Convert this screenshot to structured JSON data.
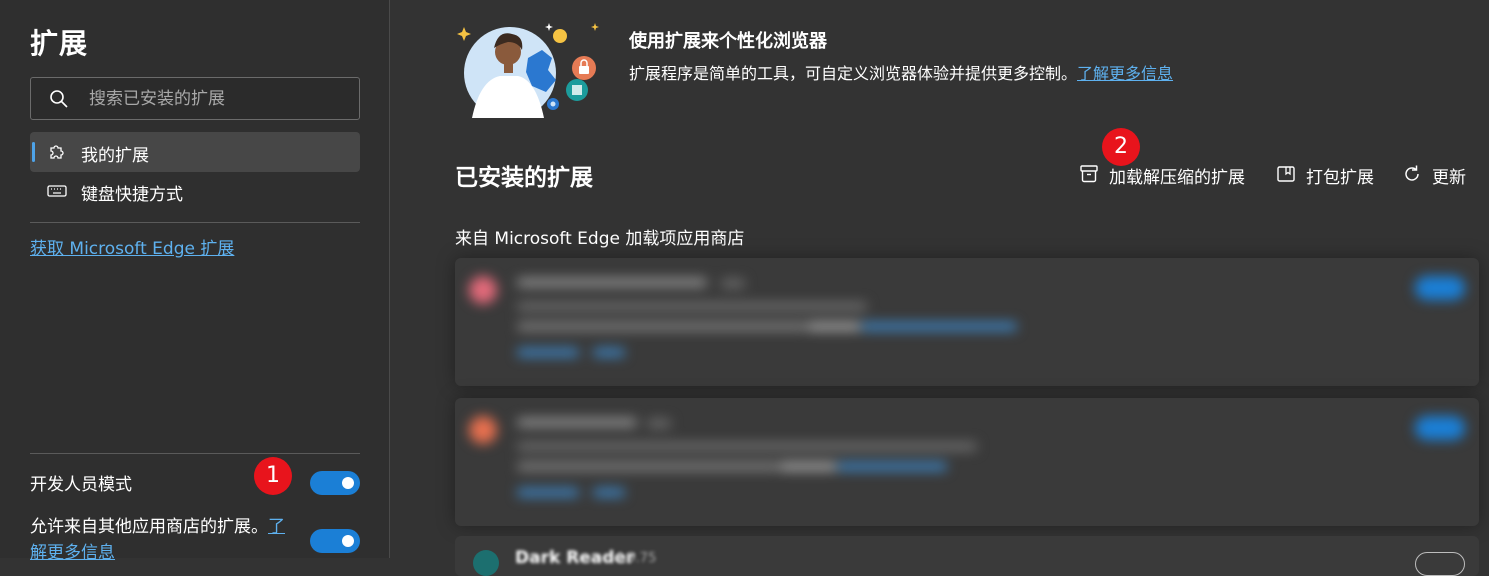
{
  "sidebar": {
    "title": "扩展",
    "search_placeholder": "搜索已安装的扩展",
    "nav": [
      {
        "label": "我的扩展",
        "icon": "puzzle-icon",
        "active": true
      },
      {
        "label": "键盘快捷方式",
        "icon": "keyboard-icon",
        "active": false
      }
    ],
    "store_link": "获取 Microsoft Edge 扩展",
    "developer_mode_label": "开发人员模式",
    "developer_mode_on": true,
    "allow_other_stores_text": "允许来自其他应用商店的扩展。",
    "allow_other_stores_link": "了解更多信息",
    "allow_other_stores_on": true
  },
  "hero": {
    "title": "使用扩展来个性化浏览器",
    "description": "扩展程序是简单的工具，可自定义浏览器体验并提供更多控制。",
    "learn_more": "了解更多信息"
  },
  "installed": {
    "title": "已安装的扩展",
    "actions": [
      {
        "label": "加载解压缩的扩展",
        "icon": "archive-icon"
      },
      {
        "label": "打包扩展",
        "icon": "package-icon"
      },
      {
        "label": "更新",
        "icon": "refresh-icon"
      }
    ],
    "source_label": "来自 Microsoft Edge 加载项应用商店",
    "third_extension_name": "Dark Reader",
    "third_extension_version": "4.9.75"
  },
  "annotations": {
    "badge1": "1",
    "badge2": "2"
  },
  "colors": {
    "background": "#333333",
    "sidebar": "#2f2f2f",
    "accent": "#1b7fd6",
    "link": "#5eb1ef",
    "badge": "#e8141c"
  }
}
